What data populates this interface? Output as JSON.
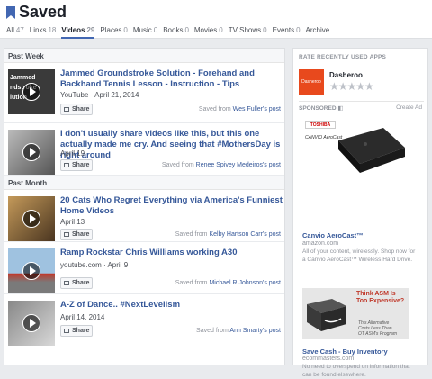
{
  "header": {
    "title": "Saved",
    "tabs": [
      {
        "label": "All",
        "count": "47"
      },
      {
        "label": "Links",
        "count": "18"
      },
      {
        "label": "Videos",
        "count": "29"
      },
      {
        "label": "Places",
        "count": "0"
      },
      {
        "label": "Music",
        "count": "0"
      },
      {
        "label": "Books",
        "count": "0"
      },
      {
        "label": "Movies",
        "count": "0"
      },
      {
        "label": "TV Shows",
        "count": "0"
      },
      {
        "label": "Events",
        "count": "0"
      },
      {
        "label": "Archive",
        "count": ""
      }
    ]
  },
  "main": {
    "sections": [
      {
        "label": "Past Week"
      },
      {
        "label": "Past Month"
      }
    ],
    "share_label": "Share",
    "saved_from_prefix": "Saved from",
    "items": [
      {
        "title": "Jammed Groundstroke Solution - Forehand and Backhand Tennis Lesson - Instruction - Tips",
        "meta": "YouTube · April 21, 2014",
        "saved_from": "Wes Fuller's post",
        "thumb_text": "Jammed\nndstroke\nlution"
      },
      {
        "title": "I don't usually share videos like this, but this one actually made me cry. And seeing that #MothersDay is right around",
        "meta": "April 19",
        "saved_from": "Renee Spivey Medeiros's post"
      },
      {
        "title": "20 Cats Who Regret Everything via America's Funniest Home Videos",
        "meta": "April 13",
        "saved_from": "Kelby Hartson Carr's post"
      },
      {
        "title": "Ramp Rockstar Chris Williams working A30",
        "meta": "youtube.com · April 9",
        "saved_from": "Michael R Johnson's post"
      },
      {
        "title": "A-Z of Dance.. #NextLevelism",
        "meta": "April 14, 2014",
        "saved_from": "Ann Smarty's post"
      }
    ]
  },
  "sidebar": {
    "recent_apps_label": "RATE RECENTLY USED APPS",
    "app": {
      "name": "Dasheroo",
      "logo_text": "Dasheroo",
      "stars": "★★★★★"
    },
    "sponsored_label": "SPONSORED",
    "create_ad_label": "Create Ad",
    "ads": [
      {
        "title": "Canvio AeroCast™",
        "domain": "amazon.com",
        "text": "All of your content, wirelessly. Shop now for a Canvio AeroCast™ Wireless Hard Drive.",
        "img_brand": "TOSHIBA",
        "img_caption": "CANVIO AeroCast"
      },
      {
        "title": "Save Cash - Buy Inventory",
        "domain": "ecommasters.com",
        "text": "No need to overspend on information that can be found elsewhere.",
        "img_line1": "Think ASM Is",
        "img_line2": "Too Expensive?",
        "img_line3": "This Alternative",
        "img_line4": "Costs Less Than",
        "img_line5": "OT ASM's Program"
      }
    ]
  }
}
